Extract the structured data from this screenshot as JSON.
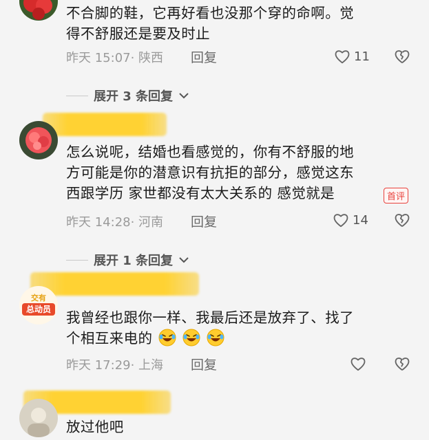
{
  "comments": [
    {
      "text_lines": [
        "不合脚的鞋，它再好看也没那个穿的命啊。觉",
        "得不舒服还是要及时止"
      ],
      "time_location": "昨天 15:07· 陕西",
      "reply_label": "回复",
      "like_count": "11"
    },
    {
      "text_lines": [
        "怎么说呢，结婚也看感觉的，你有不舒服的地",
        "方可能是你的潜意识有抗拒的部分，感觉这东",
        "西跟学历 家世都没有太大关系的 感觉就是"
      ],
      "badge": "首评",
      "time_location": "昨天 14:28· 河南",
      "reply_label": "回复",
      "like_count": "14"
    },
    {
      "text_lines": [
        "我曾经也跟你一样、我最后还是放弃了、找了",
        "个相互来电的"
      ],
      "time_location": "昨天 17:29· 上海",
      "reply_label": "回复",
      "avatar_text_top": "交有",
      "avatar_text_bottom": "总动员"
    },
    {
      "text_lines": [
        "放过他吧"
      ]
    }
  ],
  "expand_1": "展开 3 条回复",
  "expand_2": "展开 1 条回复",
  "colors": {
    "badge": "#e8413c",
    "highlight": "#ffd028",
    "meta": "#9a9a9a"
  },
  "icons": [
    "heart-outline-icon",
    "broken-heart-icon",
    "chevron-down-icon",
    "laughing-crying-emoji"
  ]
}
